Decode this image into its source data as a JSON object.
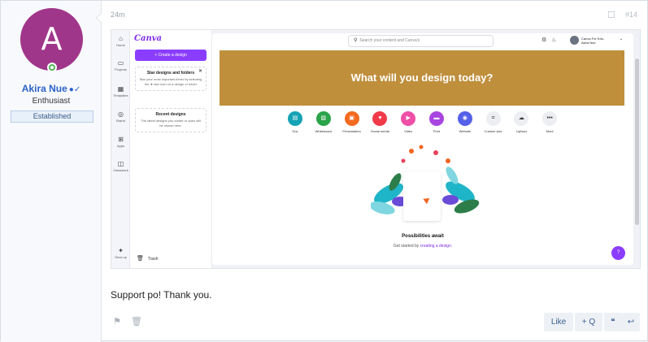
{
  "user": {
    "initial": "A",
    "name": "Akira Nue",
    "role": "Enthusiast",
    "rank": "Established",
    "avatar_color": "#a0368a",
    "online_color": "#52b45a"
  },
  "post": {
    "time": "24m",
    "post_number": "#14",
    "message": "Support po! Thank you."
  },
  "screenshot": {
    "logo": "Canva",
    "create_button": "+ Create a design",
    "nav": [
      {
        "label": "Home",
        "icon": "home-icon",
        "glyph": "⌂"
      },
      {
        "label": "Projects",
        "icon": "folder-icon",
        "glyph": "▭"
      },
      {
        "label": "Templates",
        "icon": "templates-icon",
        "glyph": "▦"
      },
      {
        "label": "Brand",
        "icon": "brand-icon",
        "glyph": "◎"
      },
      {
        "label": "Apps",
        "icon": "apps-icon",
        "glyph": "⊞"
      },
      {
        "label": "Classwork",
        "icon": "classwork-icon",
        "glyph": "◫"
      },
      {
        "label": "Glow up",
        "icon": "glow-up-icon",
        "glyph": "✦"
      }
    ],
    "star_card": {
      "title": "Star designs and folders",
      "text": "Star your most important items by selecting the ★ star icon on a design or folder"
    },
    "recent_card": {
      "title": "Recent designs",
      "text": "The latest designs you create or open will be shown here."
    },
    "trash": "Trash",
    "search_placeholder": "Search your content and Canva's",
    "profile": {
      "team": "Canva For Edu..",
      "name": "Akira Nue"
    },
    "banner_text": "What will you design today?",
    "banner_color": "#bf8f3c",
    "categories": [
      {
        "label": "Doc",
        "color": "#13a3b4",
        "glyph": "▤"
      },
      {
        "label": "Whiteboard",
        "color": "#2aa34a",
        "glyph": "▧"
      },
      {
        "label": "Presentation",
        "color": "#f36a21",
        "glyph": "▣"
      },
      {
        "label": "Social media",
        "color": "#f03a4a",
        "glyph": "♥"
      },
      {
        "label": "Video",
        "color": "#ef4fa6",
        "glyph": "▶"
      },
      {
        "label": "Print",
        "color": "#a845e0",
        "glyph": "▬"
      },
      {
        "label": "Website",
        "color": "#5561e8",
        "glyph": "◉"
      },
      {
        "label": "Custom size",
        "color": "#eceef2",
        "glyph": "⌗"
      },
      {
        "label": "Upload",
        "color": "#eceef2",
        "glyph": "☁"
      },
      {
        "label": "More",
        "color": "#eceef2",
        "glyph": "•••"
      }
    ],
    "possibilities_title": "Possibilities await",
    "get_started_prefix": "Get started by ",
    "get_started_link": "creating a design.",
    "help": "?"
  },
  "actions": {
    "like": "Like",
    "quote": "+ Q",
    "multi_quote": "❝",
    "reply": "↩"
  }
}
